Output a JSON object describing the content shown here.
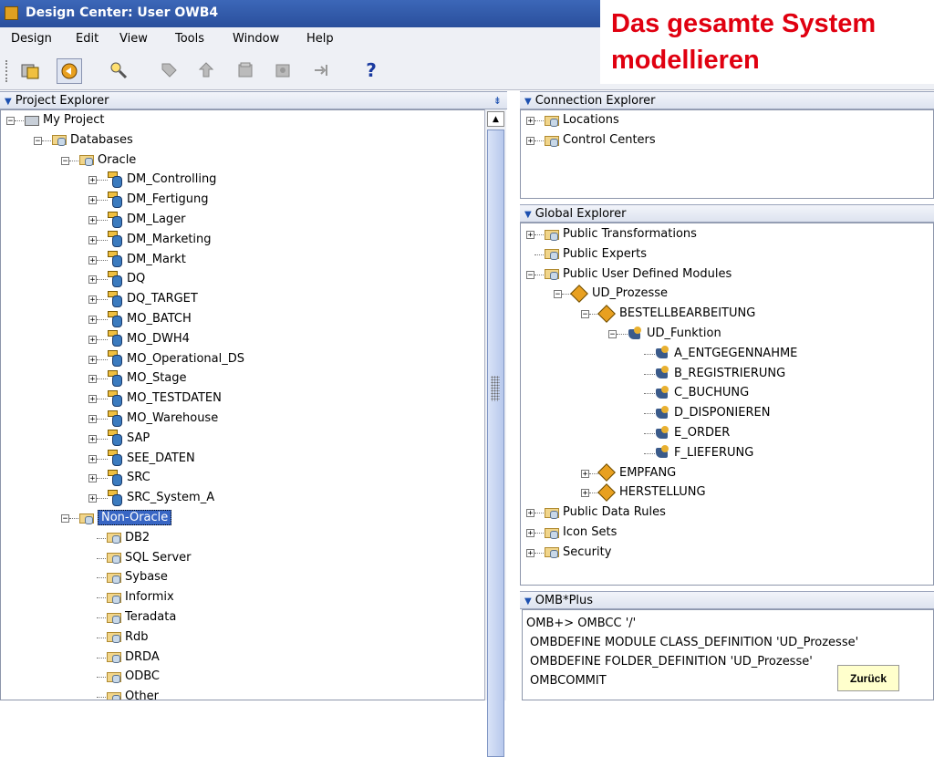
{
  "window": {
    "title": "Design Center: User OWB4"
  },
  "menu": [
    "Design",
    "Edit",
    "View",
    "Tools",
    "Window",
    "Help"
  ],
  "toolbar": {
    "help_label": "?"
  },
  "overlay": {
    "line1": "Das gesamte System",
    "line2": "modellieren"
  },
  "project_explorer": {
    "header": "Project Explorer",
    "root": "My Project",
    "databases": "Databases",
    "oracle": "Oracle",
    "oracle_modules": [
      "DM_Controlling",
      "DM_Fertigung",
      "DM_Lager",
      "DM_Marketing",
      "DM_Markt",
      "DQ",
      "DQ_TARGET",
      "MO_BATCH",
      "MO_DWH4",
      "MO_Operational_DS",
      "MO_Stage",
      "MO_TESTDATEN",
      "MO_Warehouse",
      "SAP",
      "SEE_DATEN",
      "SRC",
      "SRC_System_A"
    ],
    "non_oracle": "Non-Oracle",
    "non_oracle_items": [
      "DB2",
      "SQL Server",
      "Sybase",
      "Informix",
      "Teradata",
      "Rdb",
      "DRDA",
      "ODBC",
      "Other"
    ]
  },
  "connection_explorer": {
    "header": "Connection Explorer",
    "items": [
      "Locations",
      "Control Centers"
    ]
  },
  "global_explorer": {
    "header": "Global Explorer",
    "public_transformations": "Public Transformations",
    "public_experts": "Public Experts",
    "public_udm": "Public User Defined Modules",
    "ud_prozesse": "UD_Prozesse",
    "bestellbearbeitung": "BESTELLBEARBEITUNG",
    "ud_funktion": "UD_Funktion",
    "functions": [
      "A_ENTGEGENNAHME",
      "B_REGISTRIERUNG",
      "C_BUCHUNG",
      "D_DISPONIEREN",
      "E_ORDER",
      "F_LIEFERUNG"
    ],
    "empfang": "EMPFANG",
    "herstellung": "HERSTELLUNG",
    "public_data_rules": "Public Data Rules",
    "icon_sets": "Icon Sets",
    "security": "Security"
  },
  "omb": {
    "header": "OMB*Plus",
    "lines": [
      "OMB+> OMBCC '/'",
      "OMBDEFINE MODULE CLASS_DEFINITION 'UD_Prozesse'",
      "OMBDEFINE FOLDER_DEFINITION 'UD_Prozesse'",
      "OMBCOMMIT"
    ]
  },
  "back_button": "Zurück"
}
